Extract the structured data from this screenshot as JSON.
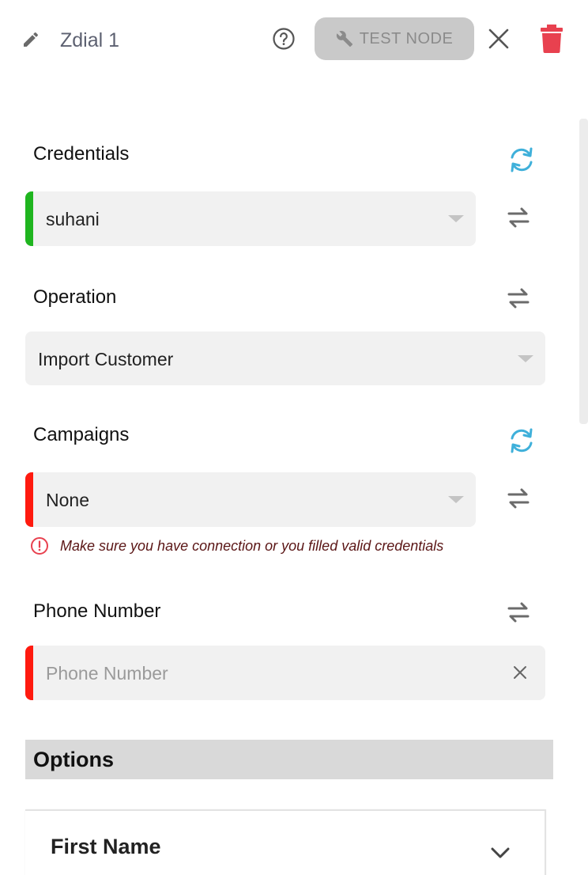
{
  "header": {
    "title": "Zdial 1",
    "test_button_label": "TEST NODE",
    "icons": [
      "pencil-icon",
      "help-circle-icon",
      "wrench-icon",
      "close-icon",
      "trash-icon"
    ]
  },
  "fields": {
    "credentials": {
      "label": "Credentials",
      "value": "suhani",
      "status_color": "#1fb51f"
    },
    "operation": {
      "label": "Operation",
      "value": "Import Customer"
    },
    "campaigns": {
      "label": "Campaigns",
      "value": "None",
      "status_color": "#ff1a0f",
      "error": "Make sure you have connection or you filled valid credentials"
    },
    "phone_number": {
      "label": "Phone Number",
      "placeholder": "Phone Number",
      "value": "",
      "status_color": "#ff1a0f"
    }
  },
  "options": {
    "title": "Options",
    "items": [
      {
        "label": "First Name"
      }
    ]
  },
  "colors": {
    "accent_refresh": "#3fb0da",
    "danger": "#e8414f",
    "button_disabled_bg": "#c9c9c9"
  }
}
